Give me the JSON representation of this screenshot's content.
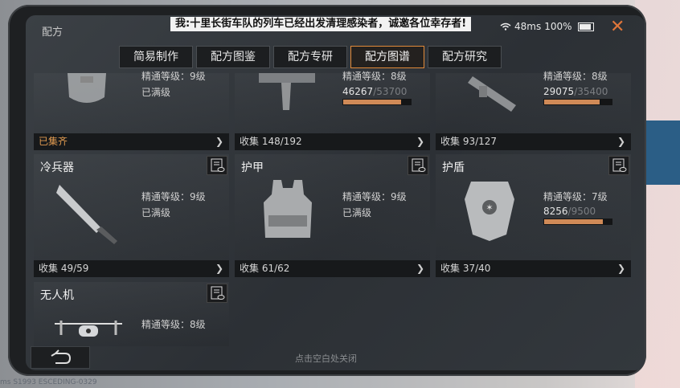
{
  "header": {
    "title": "配方",
    "marquee": "我:十里长街车队的列车已经出发清理感染者，诚邀各位幸存者!",
    "ping": "48ms",
    "battery": "100%"
  },
  "tabs": [
    {
      "label": "简易制作"
    },
    {
      "label": "配方图鉴"
    },
    {
      "label": "配方专研"
    },
    {
      "label": "配方图谱",
      "active": true
    },
    {
      "label": "配方研究"
    }
  ],
  "cards": [
    {
      "name": "",
      "mastery": "精通等级：9级",
      "maxed": "已满级",
      "collection": "已集齐",
      "icon": "backpack-icon"
    },
    {
      "name": "",
      "mastery": "精通等级：8级",
      "progress": {
        "current": "46267",
        "max": "/53700",
        "fraction": 0.86
      },
      "collection": "收集 148/192",
      "icon": "gun-icon"
    },
    {
      "name": "",
      "mastery": "精通等级：8级",
      "progress": {
        "current": "29075",
        "max": "/35400",
        "fraction": 0.82
      },
      "collection": "收集 93/127",
      "icon": "launcher-icon"
    },
    {
      "name": "冷兵器",
      "mastery": "精通等级：9级",
      "maxed": "已满级",
      "collection": "收集 49/59",
      "icon": "machete-icon"
    },
    {
      "name": "护甲",
      "mastery": "精通等级：9级",
      "maxed": "已满级",
      "collection": "收集 61/62",
      "icon": "armor-vest-icon"
    },
    {
      "name": "护盾",
      "mastery": "精通等级：7级",
      "progress": {
        "current": "8256",
        "max": "/9500",
        "fraction": 0.87
      },
      "collection": "收集 37/40",
      "icon": "shield-icon"
    },
    {
      "name": "无人机",
      "mastery": "精通等级：8级",
      "icon": "drone-icon"
    }
  ],
  "footer": {
    "hint": "点击空白处关闭",
    "watermark": "ms    S1993 ESCEDING-0329"
  },
  "colors": {
    "accent": "#e18a3a",
    "progress": "#d08a57"
  }
}
